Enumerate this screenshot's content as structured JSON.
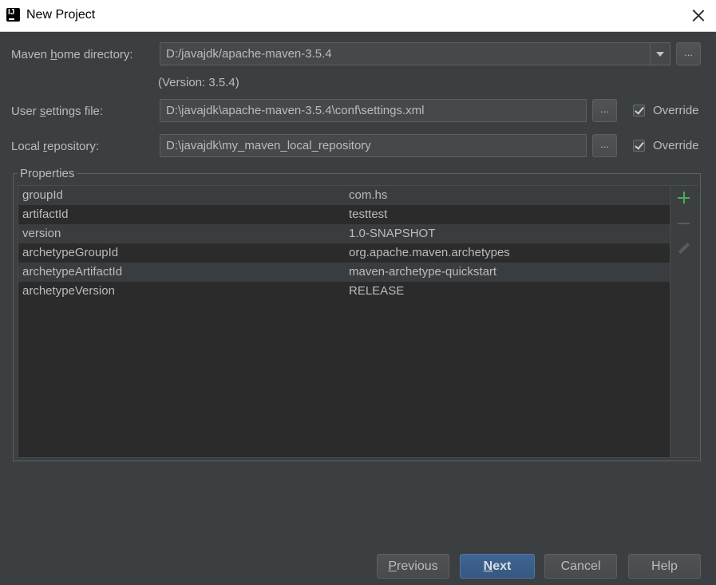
{
  "window": {
    "title": "New Project",
    "icon": "intellij-idea-icon"
  },
  "maven_home": {
    "label_pre": "Maven ",
    "label_mnemonic": "h",
    "label_post": "ome directory:",
    "value": "D:/javajdk/apache-maven-3.5.4",
    "browse_label": "...",
    "version_text": "(Version: 3.5.4)"
  },
  "user_settings": {
    "label_pre": "User ",
    "label_mnemonic": "s",
    "label_post": "ettings file:",
    "value": "D:\\javajdk\\apache-maven-3.5.4\\conf\\settings.xml",
    "browse_label": "...",
    "override_label": "Override",
    "override_checked": true
  },
  "local_repo": {
    "label_pre": "Local ",
    "label_mnemonic": "r",
    "label_post": "epository:",
    "value": "D:\\javajdk\\my_maven_local_repository",
    "browse_label": "...",
    "override_label": "Override",
    "override_checked": true
  },
  "properties": {
    "title": "Properties",
    "rows": [
      {
        "key": "groupId",
        "value": "com.hs"
      },
      {
        "key": "artifactId",
        "value": "testtest"
      },
      {
        "key": "version",
        "value": "1.0-SNAPSHOT"
      },
      {
        "key": "archetypeGroupId",
        "value": "org.apache.maven.archetypes"
      },
      {
        "key": "archetypeArtifactId",
        "value": "maven-archetype-quickstart"
      },
      {
        "key": "archetypeVersion",
        "value": "RELEASE"
      }
    ],
    "toolbar": [
      "plus-icon",
      "minus-icon",
      "edit-icon"
    ]
  },
  "buttons": {
    "previous_mnemonic": "P",
    "previous_rest": "revious",
    "next_mnemonic": "N",
    "next_rest": "ext",
    "cancel": "Cancel",
    "help": "Help"
  },
  "colors": {
    "background": "#3c3f41",
    "field_bg": "#45494a",
    "table_bg": "#2b2b2b",
    "primary_button": "#365880",
    "add_icon": "#4caf50"
  }
}
